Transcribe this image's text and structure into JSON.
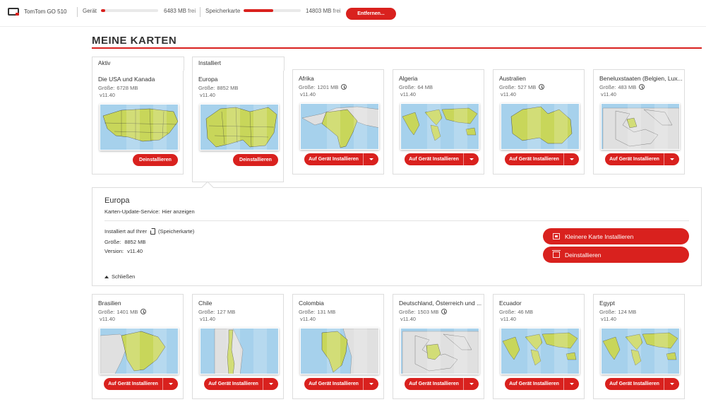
{
  "topbar": {
    "device_name": "TomTom GO 510",
    "storage": [
      {
        "label": "Gerät",
        "value": "6483 MB",
        "suffix": "frei",
        "fill_percent": 8
      },
      {
        "label": "Speicherkarte",
        "value": "14803 MB",
        "suffix": "frei",
        "fill_percent": 52
      }
    ],
    "remove_label": "Entfernen..."
  },
  "page_title": "MEINE KARTEN",
  "tabs": {
    "active": "Aktiv",
    "installed": "Installiert"
  },
  "size_label": "Größe:",
  "cards": [
    {
      "name": "Die USA und Kanada",
      "size": "6728 MB",
      "version": "v11.40",
      "clock": false,
      "button": "Deinstallieren",
      "map": "usa"
    },
    {
      "name": "Europa",
      "size": "8852 MB",
      "version": "v11.40",
      "clock": false,
      "button": "Deinstallieren",
      "map": "europe"
    },
    {
      "name": "Afrika",
      "size": "1201 MB",
      "version": "v11.40",
      "clock": true,
      "button": "Auf Gerät Installieren",
      "map": "africa"
    },
    {
      "name": "Algeria",
      "size": "64 MB",
      "version": "v11.40",
      "clock": false,
      "button": "Auf Gerät Installieren",
      "map": "world"
    },
    {
      "name": "Australien",
      "size": "527 MB",
      "version": "v11.40",
      "clock": true,
      "button": "Auf Gerät Installieren",
      "map": "australia"
    },
    {
      "name": "Beneluxstaaten (Belgien, Lux...",
      "size": "483 MB",
      "version": "v11.40",
      "clock": true,
      "button": "Auf Gerät Installieren",
      "map": "benelux"
    },
    {
      "name": "Brasilien",
      "size": "1401 MB",
      "version": "v11.40",
      "clock": true,
      "button": "Auf Gerät Installieren",
      "map": "brazil"
    },
    {
      "name": "Chile",
      "size": "127 MB",
      "version": "v11.40",
      "clock": false,
      "button": "Auf Gerät Installieren",
      "map": "chile"
    },
    {
      "name": "Colombia",
      "size": "131 MB",
      "version": "v11.40",
      "clock": false,
      "button": "Auf Gerät Installieren",
      "map": "colombia"
    },
    {
      "name": "Deutschland, Österreich und ...",
      "size": "1503 MB",
      "version": "v11.40",
      "clock": true,
      "button": "Auf Gerät Installieren",
      "map": "dach"
    },
    {
      "name": "Ecuador",
      "size": "46 MB",
      "version": "v11.40",
      "clock": false,
      "button": "Auf Gerät Installieren",
      "map": "world"
    },
    {
      "name": "Egypt",
      "size": "124 MB",
      "version": "v11.40",
      "clock": false,
      "button": "Auf Gerät Installieren",
      "map": "world"
    }
  ],
  "detail": {
    "title": "Europa",
    "service_label": "Karten-Update-Service:",
    "service_link": "Hier anzeigen",
    "installed_on": "Installiert auf Ihrer",
    "storage_name": "(Speicherkarte)",
    "size_label": "Größe:",
    "size": "8852 MB",
    "version_label": "Version:",
    "version": "v11.40",
    "close_label": "Schließen",
    "smaller_map_label": "Kleinere Karte Installieren",
    "uninstall_label": "Deinstallieren"
  },
  "colors": {
    "accent": "#d9211e",
    "map_water": "#a6d1ec",
    "map_land": "#c8d65a",
    "map_other": "#e0e0e0"
  }
}
